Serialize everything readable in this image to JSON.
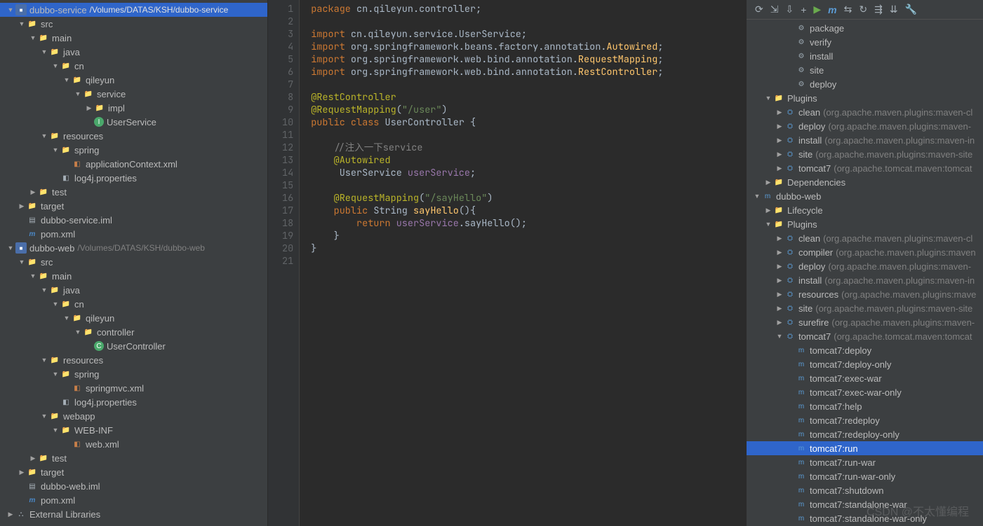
{
  "leftTree": [
    {
      "d": 0,
      "a": "open",
      "ic": "mod",
      "t": "■",
      "lbl": "dubbo-service",
      "path": "/Volumes/DATAS/KSH/dubbo-service",
      "sel": true
    },
    {
      "d": 1,
      "a": "open",
      "ic": "dirblue",
      "t": "📁",
      "lbl": "src"
    },
    {
      "d": 2,
      "a": "open",
      "ic": "dirblue",
      "t": "📁",
      "lbl": "main"
    },
    {
      "d": 3,
      "a": "open",
      "ic": "dirblue",
      "t": "📁",
      "lbl": "java"
    },
    {
      "d": 4,
      "a": "open",
      "ic": "pkg",
      "t": "📁",
      "lbl": "cn"
    },
    {
      "d": 5,
      "a": "open",
      "ic": "pkg",
      "t": "📁",
      "lbl": "qileyun"
    },
    {
      "d": 6,
      "a": "open",
      "ic": "pkg",
      "t": "📁",
      "lbl": "service"
    },
    {
      "d": 7,
      "a": "closed",
      "ic": "pkg",
      "t": "📁",
      "lbl": "impl"
    },
    {
      "d": 7,
      "a": "none",
      "ic": "iface",
      "t": "I",
      "lbl": "UserService"
    },
    {
      "d": 3,
      "a": "open",
      "ic": "dirblue",
      "t": "📁",
      "lbl": "resources"
    },
    {
      "d": 4,
      "a": "open",
      "ic": "pkg",
      "t": "📁",
      "lbl": "spring"
    },
    {
      "d": 5,
      "a": "none",
      "ic": "xml",
      "t": "◧",
      "lbl": "applicationContext.xml"
    },
    {
      "d": 4,
      "a": "none",
      "ic": "file",
      "t": "◧",
      "lbl": "log4j.properties"
    },
    {
      "d": 2,
      "a": "closed",
      "ic": "dirblue",
      "t": "📁",
      "lbl": "test"
    },
    {
      "d": 1,
      "a": "closed",
      "ic": "dirorange",
      "t": "📁",
      "lbl": "target"
    },
    {
      "d": 1,
      "a": "none",
      "ic": "file",
      "t": "▤",
      "lbl": "dubbo-service.iml"
    },
    {
      "d": 1,
      "a": "none",
      "ic": "mvn",
      "t": "m",
      "lbl": "pom.xml"
    },
    {
      "d": 0,
      "a": "open",
      "ic": "mod",
      "t": "■",
      "lbl": "dubbo-web",
      "path": "/Volumes/DATAS/KSH/dubbo-web"
    },
    {
      "d": 1,
      "a": "open",
      "ic": "dirblue",
      "t": "📁",
      "lbl": "src"
    },
    {
      "d": 2,
      "a": "open",
      "ic": "dirblue",
      "t": "📁",
      "lbl": "main"
    },
    {
      "d": 3,
      "a": "open",
      "ic": "dirblue",
      "t": "📁",
      "lbl": "java"
    },
    {
      "d": 4,
      "a": "open",
      "ic": "pkg",
      "t": "📁",
      "lbl": "cn"
    },
    {
      "d": 5,
      "a": "open",
      "ic": "pkg",
      "t": "📁",
      "lbl": "qileyun"
    },
    {
      "d": 6,
      "a": "open",
      "ic": "pkg",
      "t": "📁",
      "lbl": "controller"
    },
    {
      "d": 7,
      "a": "none",
      "ic": "cls",
      "t": "C",
      "lbl": "UserController"
    },
    {
      "d": 3,
      "a": "open",
      "ic": "dirblue",
      "t": "📁",
      "lbl": "resources"
    },
    {
      "d": 4,
      "a": "open",
      "ic": "pkg",
      "t": "📁",
      "lbl": "spring"
    },
    {
      "d": 5,
      "a": "none",
      "ic": "xml",
      "t": "◧",
      "lbl": "springmvc.xml"
    },
    {
      "d": 4,
      "a": "none",
      "ic": "file",
      "t": "◧",
      "lbl": "log4j.properties"
    },
    {
      "d": 3,
      "a": "open",
      "ic": "dirblue",
      "t": "📁",
      "lbl": "webapp"
    },
    {
      "d": 4,
      "a": "open",
      "ic": "pkg",
      "t": "📁",
      "lbl": "WEB-INF"
    },
    {
      "d": 5,
      "a": "none",
      "ic": "xml",
      "t": "◧",
      "lbl": "web.xml"
    },
    {
      "d": 2,
      "a": "closed",
      "ic": "dirblue",
      "t": "📁",
      "lbl": "test"
    },
    {
      "d": 1,
      "a": "closed",
      "ic": "dirorange",
      "t": "📁",
      "lbl": "target"
    },
    {
      "d": 1,
      "a": "none",
      "ic": "file",
      "t": "▤",
      "lbl": "dubbo-web.iml"
    },
    {
      "d": 1,
      "a": "none",
      "ic": "mvn",
      "t": "m",
      "lbl": "pom.xml"
    },
    {
      "d": 0,
      "a": "closed",
      "ic": "file",
      "t": "⛬",
      "lbl": "External Libraries"
    }
  ],
  "code": [
    [
      {
        "c": "kw",
        "s": "package"
      },
      {
        "c": "ident",
        "s": " cn.qileyun.controller"
      },
      {
        "c": "punc",
        "s": ";"
      }
    ],
    [],
    [
      {
        "c": "kw",
        "s": "import"
      },
      {
        "c": "ident",
        "s": " cn.qileyun.service.UserService"
      },
      {
        "c": "punc",
        "s": ";"
      }
    ],
    [
      {
        "c": "kw",
        "s": "import"
      },
      {
        "c": "ident",
        "s": " org.springframework.beans.factory.annotation."
      },
      {
        "c": "dec",
        "s": "Autowired"
      },
      {
        "c": "punc",
        "s": ";"
      }
    ],
    [
      {
        "c": "kw",
        "s": "import"
      },
      {
        "c": "ident",
        "s": " org.springframework.web.bind.annotation."
      },
      {
        "c": "dec",
        "s": "RequestMapping"
      },
      {
        "c": "punc",
        "s": ";"
      }
    ],
    [
      {
        "c": "kw",
        "s": "import"
      },
      {
        "c": "ident",
        "s": " org.springframework.web.bind.annotation."
      },
      {
        "c": "dec",
        "s": "RestController"
      },
      {
        "c": "punc",
        "s": ";"
      }
    ],
    [],
    [
      {
        "c": "ann",
        "s": "@RestController"
      }
    ],
    [
      {
        "c": "ann",
        "s": "@RequestMapping"
      },
      {
        "c": "punc",
        "s": "("
      },
      {
        "c": "str",
        "s": "\"/user\""
      },
      {
        "c": "punc",
        "s": ")"
      }
    ],
    [
      {
        "c": "kw",
        "s": "public class "
      },
      {
        "c": "ident",
        "s": "UserController "
      },
      {
        "c": "punc",
        "s": "{"
      }
    ],
    [],
    [
      {
        "c": "cmt",
        "s": "    //注入一下service"
      }
    ],
    [
      {
        "c": "ann",
        "s": "    @Autowired"
      }
    ],
    [
      {
        "c": "ident",
        "s": "     UserService "
      },
      {
        "c": "fld",
        "s": "userService"
      },
      {
        "c": "punc",
        "s": ";"
      }
    ],
    [],
    [
      {
        "c": "ann",
        "s": "    @RequestMapping"
      },
      {
        "c": "punc",
        "s": "("
      },
      {
        "c": "str",
        "s": "\"/sayHello\""
      },
      {
        "c": "punc",
        "s": ")"
      }
    ],
    [
      {
        "c": "kw",
        "s": "    public "
      },
      {
        "c": "ident",
        "s": "String "
      },
      {
        "c": "dec",
        "s": "sayHello"
      },
      {
        "c": "punc",
        "s": "(){"
      }
    ],
    [
      {
        "c": "kw",
        "s": "        return "
      },
      {
        "c": "fld",
        "s": "userService"
      },
      {
        "c": "ident",
        "s": ".sayHello()"
      },
      {
        "c": "punc",
        "s": ";"
      }
    ],
    [
      {
        "c": "punc",
        "s": "    }"
      }
    ],
    [
      {
        "c": "punc",
        "s": "}"
      }
    ],
    []
  ],
  "toolbar": [
    "⟳",
    "⇲",
    "⇩",
    "+",
    "▶",
    "m",
    "⇆",
    "↻",
    "⇶",
    "⇊",
    "🔧"
  ],
  "rightTree": [
    {
      "d": 3,
      "a": "none",
      "ic": "gear",
      "t": "⚙",
      "lbl": "package"
    },
    {
      "d": 3,
      "a": "none",
      "ic": "gear",
      "t": "⚙",
      "lbl": "verify"
    },
    {
      "d": 3,
      "a": "none",
      "ic": "gear",
      "t": "⚙",
      "lbl": "install"
    },
    {
      "d": 3,
      "a": "none",
      "ic": "gear",
      "t": "⚙",
      "lbl": "site"
    },
    {
      "d": 3,
      "a": "none",
      "ic": "gear",
      "t": "⚙",
      "lbl": "deploy"
    },
    {
      "d": 1,
      "a": "open",
      "ic": "folder",
      "t": "📁",
      "lbl": "Plugins"
    },
    {
      "d": 2,
      "a": "closed",
      "ic": "m-blue",
      "t": "⛭",
      "lbl": "clean",
      "grey": "(org.apache.maven.plugins:maven-cl"
    },
    {
      "d": 2,
      "a": "closed",
      "ic": "m-blue",
      "t": "⛭",
      "lbl": "deploy",
      "grey": "(org.apache.maven.plugins:maven-"
    },
    {
      "d": 2,
      "a": "closed",
      "ic": "m-blue",
      "t": "⛭",
      "lbl": "install",
      "grey": "(org.apache.maven.plugins:maven-in"
    },
    {
      "d": 2,
      "a": "closed",
      "ic": "m-blue",
      "t": "⛭",
      "lbl": "site",
      "grey": "(org.apache.maven.plugins:maven-site"
    },
    {
      "d": 2,
      "a": "closed",
      "ic": "m-blue",
      "t": "⛭",
      "lbl": "tomcat7",
      "grey": "(org.apache.tomcat.maven:tomcat"
    },
    {
      "d": 1,
      "a": "closed",
      "ic": "folder",
      "t": "📁",
      "lbl": "Dependencies"
    },
    {
      "d": 0,
      "a": "open",
      "ic": "m-blue",
      "t": "m",
      "lbl": "dubbo-web"
    },
    {
      "d": 1,
      "a": "closed",
      "ic": "folder",
      "t": "📁",
      "lbl": "Lifecycle"
    },
    {
      "d": 1,
      "a": "open",
      "ic": "folder",
      "t": "📁",
      "lbl": "Plugins"
    },
    {
      "d": 2,
      "a": "closed",
      "ic": "m-blue",
      "t": "⛭",
      "lbl": "clean",
      "grey": "(org.apache.maven.plugins:maven-cl"
    },
    {
      "d": 2,
      "a": "closed",
      "ic": "m-blue",
      "t": "⛭",
      "lbl": "compiler",
      "grey": "(org.apache.maven.plugins:maven"
    },
    {
      "d": 2,
      "a": "closed",
      "ic": "m-blue",
      "t": "⛭",
      "lbl": "deploy",
      "grey": "(org.apache.maven.plugins:maven-"
    },
    {
      "d": 2,
      "a": "closed",
      "ic": "m-blue",
      "t": "⛭",
      "lbl": "install",
      "grey": "(org.apache.maven.plugins:maven-in"
    },
    {
      "d": 2,
      "a": "closed",
      "ic": "m-blue",
      "t": "⛭",
      "lbl": "resources",
      "grey": "(org.apache.maven.plugins:mave"
    },
    {
      "d": 2,
      "a": "closed",
      "ic": "m-blue",
      "t": "⛭",
      "lbl": "site",
      "grey": "(org.apache.maven.plugins:maven-site"
    },
    {
      "d": 2,
      "a": "closed",
      "ic": "m-blue",
      "t": "⛭",
      "lbl": "surefire",
      "grey": "(org.apache.maven.plugins:maven-"
    },
    {
      "d": 2,
      "a": "open",
      "ic": "m-blue",
      "t": "⛭",
      "lbl": "tomcat7",
      "grey": "(org.apache.tomcat.maven:tomcat"
    },
    {
      "d": 3,
      "a": "none",
      "ic": "m-blue",
      "t": "m",
      "lbl": "tomcat7:deploy"
    },
    {
      "d": 3,
      "a": "none",
      "ic": "m-blue",
      "t": "m",
      "lbl": "tomcat7:deploy-only"
    },
    {
      "d": 3,
      "a": "none",
      "ic": "m-blue",
      "t": "m",
      "lbl": "tomcat7:exec-war"
    },
    {
      "d": 3,
      "a": "none",
      "ic": "m-blue",
      "t": "m",
      "lbl": "tomcat7:exec-war-only"
    },
    {
      "d": 3,
      "a": "none",
      "ic": "m-blue",
      "t": "m",
      "lbl": "tomcat7:help"
    },
    {
      "d": 3,
      "a": "none",
      "ic": "m-blue",
      "t": "m",
      "lbl": "tomcat7:redeploy"
    },
    {
      "d": 3,
      "a": "none",
      "ic": "m-blue",
      "t": "m",
      "lbl": "tomcat7:redeploy-only"
    },
    {
      "d": 3,
      "a": "none",
      "ic": "m-blue",
      "t": "m",
      "lbl": "tomcat7:run",
      "sel": true
    },
    {
      "d": 3,
      "a": "none",
      "ic": "m-blue",
      "t": "m",
      "lbl": "tomcat7:run-war"
    },
    {
      "d": 3,
      "a": "none",
      "ic": "m-blue",
      "t": "m",
      "lbl": "tomcat7:run-war-only"
    },
    {
      "d": 3,
      "a": "none",
      "ic": "m-blue",
      "t": "m",
      "lbl": "tomcat7:shutdown"
    },
    {
      "d": 3,
      "a": "none",
      "ic": "m-blue",
      "t": "m",
      "lbl": "tomcat7:standalone-war"
    },
    {
      "d": 3,
      "a": "none",
      "ic": "m-blue",
      "t": "m",
      "lbl": "tomcat7:standalone-war-only"
    }
  ],
  "watermark": "CSDN @不太懂编程"
}
